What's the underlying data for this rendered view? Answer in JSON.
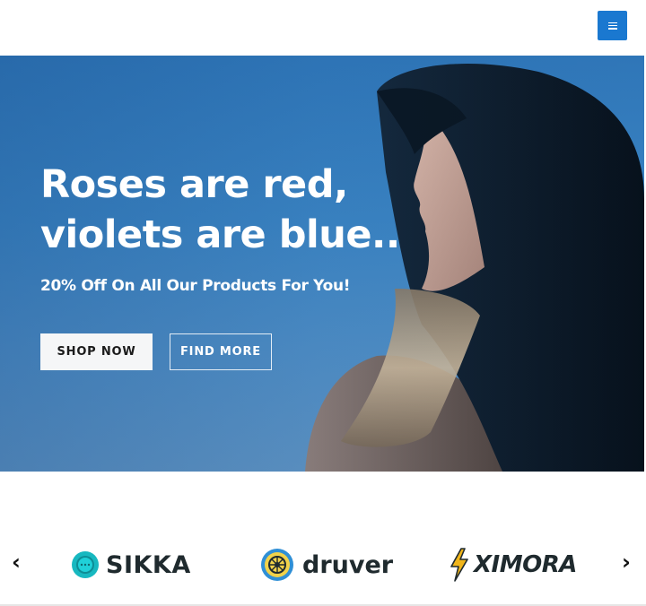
{
  "header": {
    "menu_icon": "hamburger-menu-icon",
    "accent_color": "#1a78d0"
  },
  "hero": {
    "title_line1": "Roses are red,",
    "title_line2": "violets are blue..",
    "subtitle": "20% Off On All Our Products For You!",
    "shop_button_label": "SHOP NOW",
    "find_button_label": "FIND MORE",
    "background_color": "#3a83c2"
  },
  "brands": {
    "prev_icon": "chevron-left-icon",
    "next_icon": "chevron-right-icon",
    "items": [
      {
        "name": "SIKKA",
        "icon": "sikka-logo-icon",
        "color": "#17b8c0"
      },
      {
        "name": "druver",
        "icon": "druver-logo-icon",
        "color": "#2f8fd6"
      },
      {
        "name": "XIMORA",
        "icon": "lightning-bolt-icon",
        "color": "#f0b51a"
      }
    ]
  }
}
